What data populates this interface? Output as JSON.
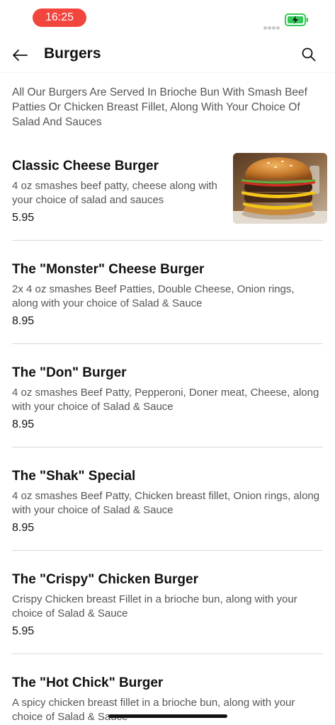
{
  "status_bar": {
    "time": "16:25",
    "battery_icon": "battery-charging-icon",
    "signal_icon": "signal-dots-icon"
  },
  "header": {
    "title": "Burgers",
    "back_icon": "back-arrow-icon",
    "search_icon": "search-icon"
  },
  "category_description": "All Our Burgers Are Served In Brioche Bun With Smash Beef Patties Or Chicken Breast Fillet, Along With Your Choice Of Salad And Sauces",
  "items": [
    {
      "name": "Classic Cheese Burger",
      "description": "4 oz smashes beef patty, cheese along  with your choice of salad and sauces",
      "price": "5.95"
    },
    {
      "name": "The \"Monster\" Cheese Burger",
      "description": "2x 4 oz smashes Beef Patties, Double Cheese, Onion rings, along with your choice of Salad & Sauce",
      "price": "8.95"
    },
    {
      "name": "The \"Don\" Burger",
      "description": "4 oz smashes Beef Patty, Pepperoni, Doner meat, Cheese, along with your choice of Salad & Sauce",
      "price": "8.95"
    },
    {
      "name": "The \"Shak\" Special",
      "description": "4 oz smashes Beef Patty, Chicken breast fillet, Onion rings, along with your choice of Salad & Sauce",
      "price": "8.95"
    },
    {
      "name": "The \"Crispy\" Chicken Burger",
      "description": "Crispy Chicken breast Fillet in a brioche bun, along with your choice of Salad & Sauce",
      "price": "5.95"
    },
    {
      "name": "The \"Hot Chick\" Burger",
      "description": "A spicy chicken breast fillet in a brioche bun, along with your choice of Salad & Sauce",
      "price": ""
    }
  ],
  "colors": {
    "time_pill": "#f2453d",
    "battery": "#34c759",
    "divider": "#d8d8d8",
    "secondary_text": "#555555"
  }
}
